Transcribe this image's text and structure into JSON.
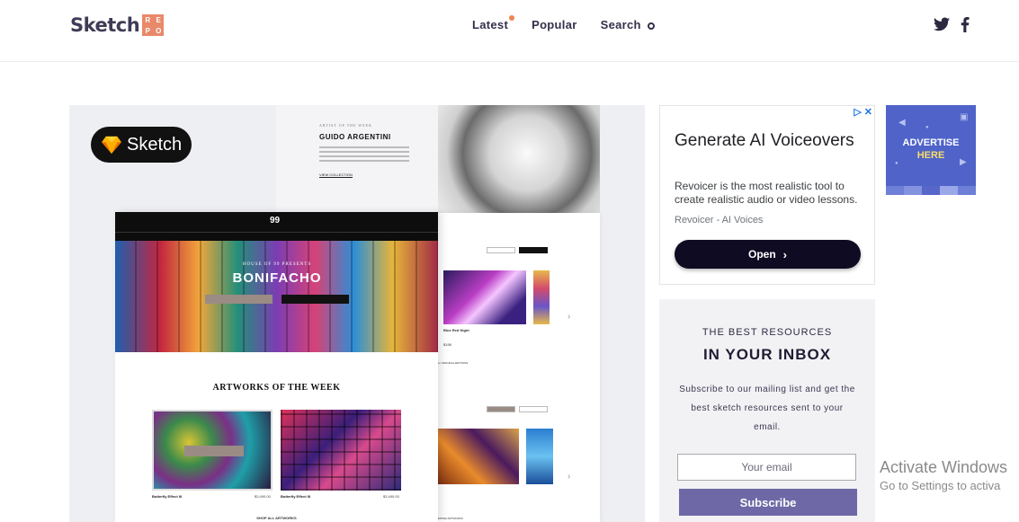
{
  "header": {
    "logo_text": "Sketch",
    "logo_badge": [
      "R",
      "E",
      "P",
      "O"
    ],
    "nav": [
      {
        "label": "Latest",
        "has_dot": true
      },
      {
        "label": "Popular",
        "has_dot": false
      },
      {
        "label": "Search",
        "has_dot": false
      }
    ],
    "social_icons": [
      "twitter-icon",
      "facebook-icon"
    ]
  },
  "hero": {
    "pill_label": "Sketch",
    "artist": {
      "kicker": "ARTIST OF THE WEEK",
      "name": "GUIDO ARGENTINI",
      "link": "VIEW COLLECTION"
    },
    "site": {
      "kicker": "HOUSE OF 99 PRESENTS",
      "title": "BONIFACHO",
      "section_title": "ARTWORKS OF THE WEEK",
      "art_a_caption": "Butterfly Effect III",
      "art_a_price": "$3,490.00",
      "art_b_caption": "Butterfly Effect III",
      "art_b_price": "$3,490.00",
      "shop_all": "SHOP ALL ARTWORKS"
    },
    "right_page": {
      "art_title": "Blue Red Night",
      "price": "$195",
      "link": "ALL ORIGINAL EDITIONS",
      "bottom_link": "LIMITED ARTWORKS"
    }
  },
  "ad": {
    "title": "Generate AI Voiceovers",
    "description": "Revoicer is the most realistic tool to create realistic audio or video lessons.",
    "source": "Revoicer - AI Voices",
    "button_label": "Open",
    "chevron": "›"
  },
  "advertise": {
    "line1": "ADVERTISE",
    "line2": "HERE",
    "colors": [
      "#6d7fd6",
      "#8393e0",
      "#5667c9",
      "#9aa7e8",
      "#6d7fd6"
    ]
  },
  "newsletter": {
    "kicker": "THE BEST RESOURCES",
    "title": "IN YOUR INBOX",
    "description": "Subscribe to our mailing list and get the best sketch resources sent to your email.",
    "input_placeholder": "Your email",
    "button_label": "Subscribe"
  },
  "watermark": {
    "line1": "Activate Windows",
    "line2": "Go to Settings to activa"
  }
}
